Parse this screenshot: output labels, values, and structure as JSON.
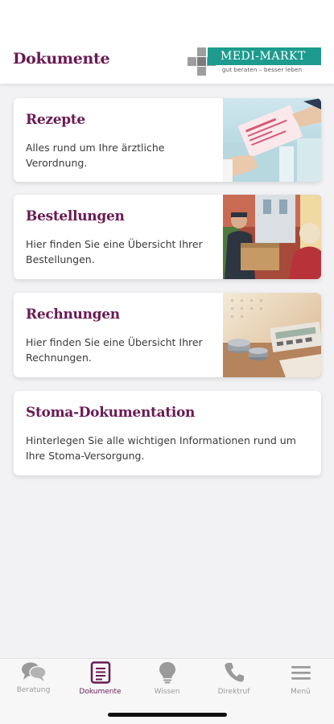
{
  "header": {
    "title": "Dokumente",
    "logo": {
      "name": "MEDI-MARKT",
      "tagline": "gut beraten – besser leben",
      "color_teal": "#1c9b8e",
      "color_gray": "#9e9e9e"
    }
  },
  "cards": [
    {
      "title": "Rezepte",
      "description": "Alles rund um Ihre ärztliche Verordnung.",
      "image": "prescription-photo"
    },
    {
      "title": "Bestellungen",
      "description": "Hier finden Sie eine Übersicht Ihrer Bestellungen.",
      "image": "delivery-photo"
    },
    {
      "title": "Rechnungen",
      "description": "Hier finden Sie eine Übersicht Ihrer Rechnungen.",
      "image": "invoice-calculator-photo"
    },
    {
      "title": "Stoma-Dokumentation",
      "description": "Hinterlegen Sie alle wichtigen Informationen rund um Ihre Stoma-Versorgung."
    }
  ],
  "tabbar": {
    "active_index": 1,
    "items": [
      {
        "label": "Beratung",
        "icon": "chat-bubbles-icon"
      },
      {
        "label": "Dokumente",
        "icon": "document-icon"
      },
      {
        "label": "Wissen",
        "icon": "lightbulb-icon"
      },
      {
        "label": "Direktruf",
        "icon": "phone-icon"
      },
      {
        "label": "Menü",
        "icon": "hamburger-menu-icon"
      }
    ]
  },
  "colors": {
    "brand": "#6a1a53",
    "background": "#f2f2f4",
    "inactive": "#9a9a9a"
  }
}
